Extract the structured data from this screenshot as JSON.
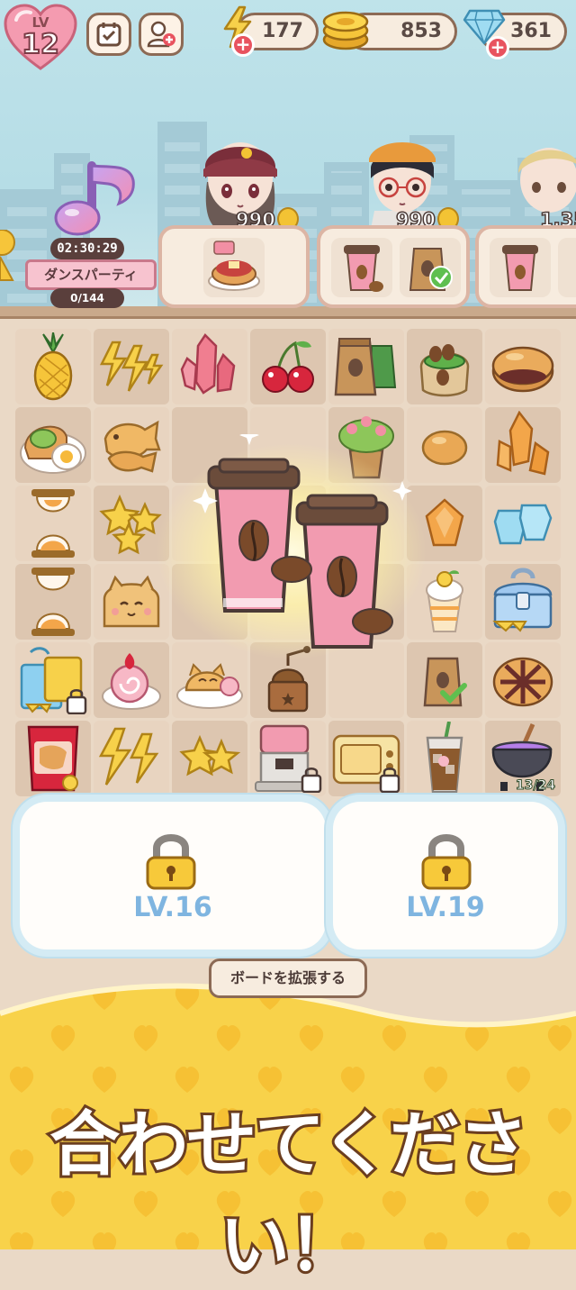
{
  "hud": {
    "level_label": "LV",
    "level": "12",
    "energy": "177",
    "coins": "853",
    "gems": "361",
    "plus_symbol": "+"
  },
  "event": {
    "timer": "02:30:29",
    "name": "ダンスパーティ",
    "progress": "0/144"
  },
  "orders": [
    {
      "reward": "990"
    },
    {
      "reward": "990"
    },
    {
      "reward": "1,35"
    }
  ],
  "board": {
    "generator_count": "13/24"
  },
  "locked_areas": [
    {
      "label": "LV.16"
    },
    {
      "label": "LV.19"
    }
  ],
  "expand_button": "ボードを拡張する",
  "banner_text": "合わせてください！",
  "colors": {
    "heart": "#f28fa4",
    "coin": "#f3c334",
    "gem": "#8fd6ee",
    "banner_yellow": "#f8d24a"
  }
}
